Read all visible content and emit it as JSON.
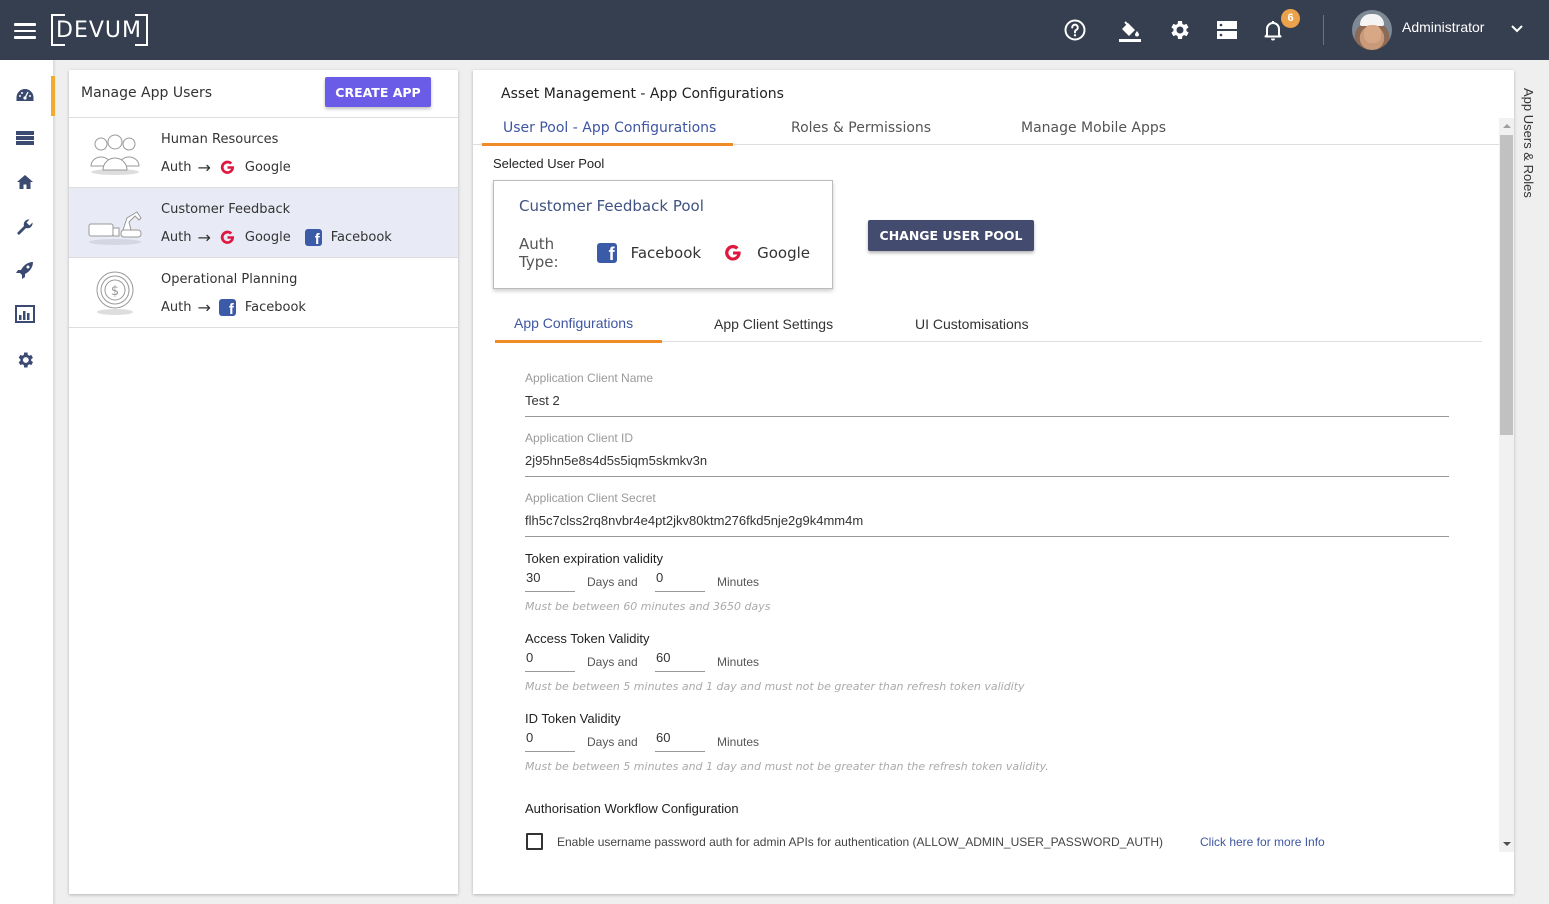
{
  "topbar": {
    "logo_text": "DEVUM",
    "notification_count": "6",
    "username": "Administrator",
    "icons": [
      "menu-icon",
      "help-icon",
      "paint-bucket-icon",
      "settings-icon",
      "server-icon",
      "bell-icon",
      "chevron-down-icon"
    ]
  },
  "rail": {
    "items": [
      "dashboard-icon",
      "list-icon",
      "home-icon",
      "wrench-icon",
      "rocket-icon",
      "chart-icon",
      "gear-icon"
    ],
    "active_index": 0
  },
  "left_panel": {
    "title": "Manage App Users",
    "create_button": "CREATE APP",
    "auth_label": "Auth",
    "apps": [
      {
        "name": "Human Resources",
        "thumb": "workers-icon",
        "providers": [
          "Google"
        ]
      },
      {
        "name": "Customer Feedback",
        "thumb": "excavator-icon",
        "providers": [
          "Google",
          "Facebook"
        ],
        "selected": true
      },
      {
        "name": "Operational Planning",
        "thumb": "coin-icon",
        "providers": [
          "Facebook"
        ]
      }
    ]
  },
  "main": {
    "title": "Asset Management - App Configurations",
    "tabs": [
      {
        "label": "User Pool - App Configurations",
        "active": true
      },
      {
        "label": "Roles & Permissions"
      },
      {
        "label": "Manage Mobile Apps"
      }
    ],
    "selected_pool_label": "Selected User Pool",
    "pool": {
      "name": "Customer Feedback Pool",
      "auth_type_label": "Auth Type:",
      "providers": [
        "Facebook",
        "Google"
      ]
    },
    "change_pool_button": "CHANGE USER POOL",
    "subtabs": [
      {
        "label": "App Configurations",
        "active": true
      },
      {
        "label": "App Client Settings"
      },
      {
        "label": "UI Customisations"
      }
    ],
    "fields": {
      "client_name": {
        "label": "Application Client Name",
        "value": "Test 2"
      },
      "client_id": {
        "label": "Application Client ID",
        "value": "2j95hn5e8s4d5s5iqm5skmkv3n"
      },
      "client_secret": {
        "label": "Application Client Secret",
        "value": "flh5c7clss2rq8nvbr4e4pt2jkv80ktm276fkd5nje2g9k4mm4m"
      }
    },
    "days_and": "Days and",
    "minutes": "Minutes",
    "token_expiration": {
      "label": "Token expiration validity",
      "days": "30",
      "minutes": "0",
      "hint": "Must be between 60 minutes and 3650 days"
    },
    "access_token": {
      "label": "Access Token Validity",
      "days": "0",
      "minutes": "60",
      "hint": "Must be between 5 minutes and 1 day and must not  be greater than refresh token validity"
    },
    "id_token": {
      "label": "ID Token Validity",
      "days": "0",
      "minutes": "60",
      "hint": "Must be between 5 minutes and 1 day and must not be greater than the refresh token validity."
    },
    "auth_workflow": {
      "label": "Authorisation Workflow Configuration",
      "checkbox_label": "Enable username password auth for admin APIs for authentication (ALLOW_ADMIN_USER_PASSWORD_AUTH)",
      "checked": false,
      "info_link": "Click here for more Info"
    }
  },
  "side_tab": "App Users & Roles",
  "colors": {
    "topbar": "#353f4f",
    "accent_orange": "#f08c28",
    "create_button": "#6b5ce7",
    "change_button": "#434b6f",
    "active_tab": "#3e56a1",
    "google_red": "#e0173f",
    "facebook_blue": "#3b5ba8",
    "badge": "#eba24a"
  }
}
